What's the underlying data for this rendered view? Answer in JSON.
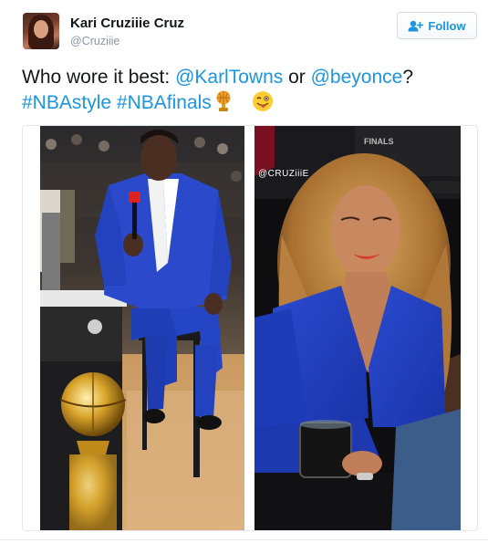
{
  "header": {
    "display_name": "Kari Cruziiie Cruz",
    "handle": "@Cruziiie",
    "follow_label": "Follow"
  },
  "tweet": {
    "line1_prefix": "Who wore it best: ",
    "mention1": "@KarlTowns",
    "line1_mid": " or ",
    "mention2": "@beyonce",
    "line1_suffix": "?",
    "hashtag1": "#NBAstyle",
    "hashtag2": "#NBAfinals",
    "emojis": [
      "basketball-trophy-icon",
      "winking-tongue-face-icon"
    ]
  },
  "media": {
    "watermark": "@CRUZiiiE",
    "photos": [
      "Karl-Anthony Towns in blue suit",
      "Beyonce in blue blazer"
    ]
  },
  "colors": {
    "link": "#1b95e0",
    "text": "#14171a",
    "secondary": "#8899a6",
    "suit_blue": "#2a48c8"
  }
}
